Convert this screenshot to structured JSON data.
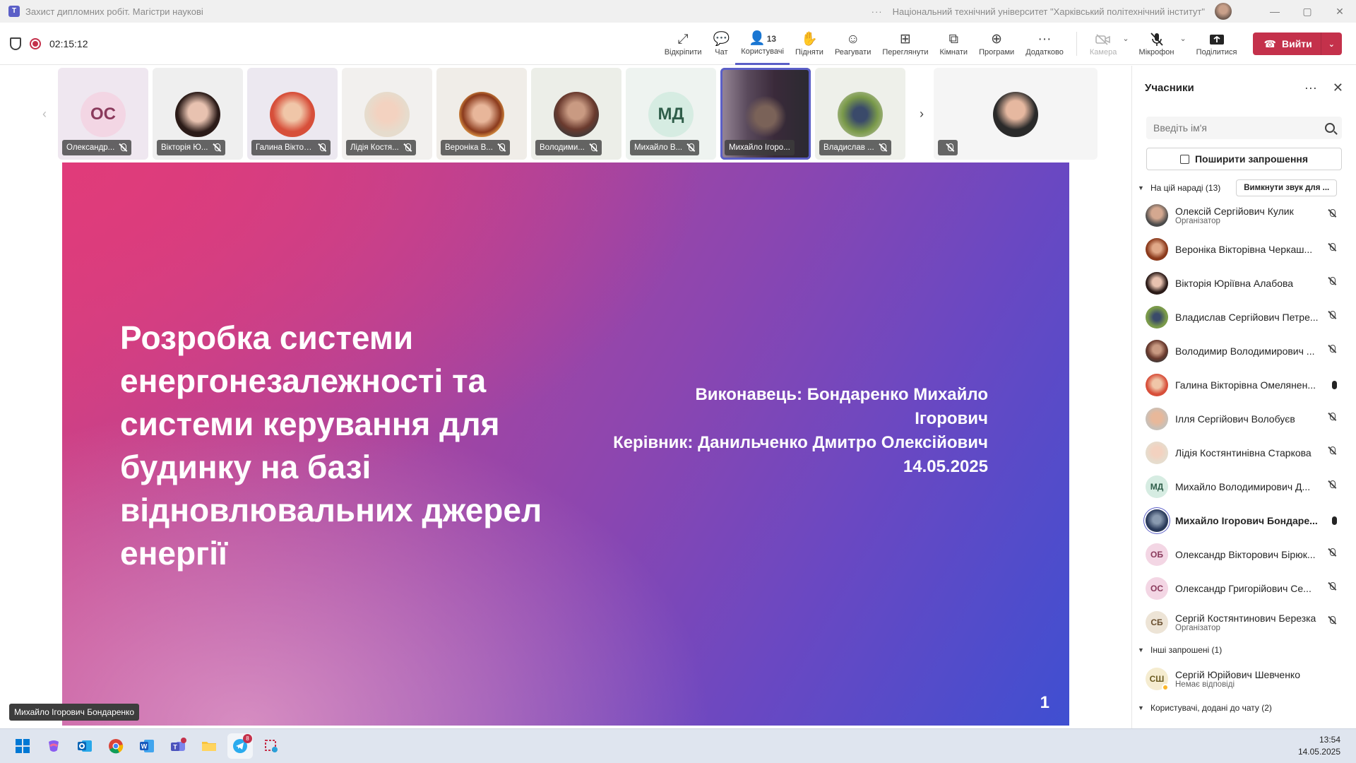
{
  "window": {
    "title": "Захист дипломних робіт. Магістри наукові",
    "org": "Національний технічний університет \"Харківський політехнічний інститут\"",
    "dots": "···",
    "min": "—",
    "max": "▢",
    "close": "✕"
  },
  "meeting": {
    "timer": "02:15:12"
  },
  "toolbar": {
    "buttons": [
      {
        "label": "Відкріпити",
        "icon": "⤢"
      },
      {
        "label": "Чат",
        "icon": "💬"
      },
      {
        "label": "Користувачі",
        "icon": "👤",
        "count": "13"
      },
      {
        "label": "Підняти",
        "icon": "✋"
      },
      {
        "label": "Реагувати",
        "icon": "☺"
      },
      {
        "label": "Переглянути",
        "icon": "⊞"
      },
      {
        "label": "Кімнати",
        "icon": "⧉"
      },
      {
        "label": "Програми",
        "icon": "⊕"
      },
      {
        "label": "Додатково",
        "icon": "···"
      }
    ],
    "camera": "Камера",
    "microphone": "Мікрофон",
    "share": "Поділитися",
    "leave": "Вийти"
  },
  "tiles": [
    {
      "name": "Олександр...",
      "initials": "ОС"
    },
    {
      "name": "Вікторія Ю..."
    },
    {
      "name": "Галина Вікторі..."
    },
    {
      "name": "Лідія Костя..."
    },
    {
      "name": "Вероніка В..."
    },
    {
      "name": "Володими..."
    },
    {
      "name": "Михайло В...",
      "initials": "МД"
    },
    {
      "name": "Михайло Ігоро..."
    },
    {
      "name": "Владислав ..."
    },
    {
      "name": ""
    }
  ],
  "slide": {
    "title": "Розробка системи енергонезалежності та системи керування для будинку на базі відновлювальних джерел енергії",
    "author_line1": "Виконавець: Бондаренко Михайло",
    "author_line2": "Ігорович",
    "supervisor": "Керівник: Данильченко Дмитро Олексійович",
    "date": "14.05.2025",
    "page": "1"
  },
  "speaker_label": "Михайло Ігорович Бондаренко",
  "panel": {
    "title": "Учасники",
    "more": "···",
    "close": "✕",
    "search_placeholder": "Введіть ім'я",
    "share_invite": "Поширити запрошення",
    "group_in_meeting": "На цій нараді (13)",
    "mute_all": "Вимкнути звук для ...",
    "participants": [
      {
        "name": "Олексій Сергійович Кулик",
        "role": "Організатор"
      },
      {
        "name": "Вероніка Вікторівна Черкаш..."
      },
      {
        "name": "Вікторія Юріївна Алабова"
      },
      {
        "name": "Владислав Сергійович Петре..."
      },
      {
        "name": "Володимир Володимирович ..."
      },
      {
        "name": "Галина Вікторівна Омелянен..."
      },
      {
        "name": "Ілля Сергійович Волобуєв"
      },
      {
        "name": "Лідія Костянтинівна Старкова"
      },
      {
        "name": "Михайло Володимирович Д...",
        "initials": "МД"
      },
      {
        "name": "Михайло Ігорович Бондаре..."
      },
      {
        "name": "Олександр Вікторович Бірюк...",
        "initials": "ОБ"
      },
      {
        "name": "Олександр Григорійович Се...",
        "initials": "ОС"
      },
      {
        "name": "Сергій Костянтинович Березка",
        "role": "Організатор",
        "initials": "СБ"
      }
    ],
    "group_invited": "Інші запрошені (1)",
    "invited": [
      {
        "name": "Сергій Юрійович Шевченко",
        "role": "Немає відповіді",
        "initials": "СШ"
      }
    ],
    "group_chat": "Користувачі, додані до чату (2)"
  },
  "taskbar": {
    "telegram_badge": "8",
    "time": "13:54",
    "date": "14.05.2025"
  }
}
